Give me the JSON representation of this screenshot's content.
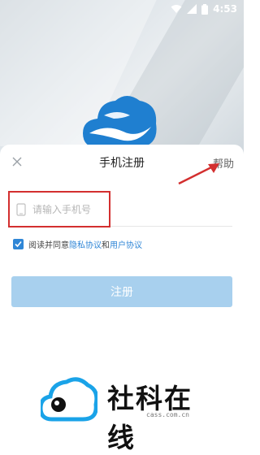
{
  "status_bar": {
    "time": "4:53",
    "icons": [
      "wifi-icon",
      "signal-icon",
      "battery-icon"
    ]
  },
  "header": {
    "close_icon": "close-icon",
    "title": "手机注册",
    "help_label": "帮助"
  },
  "form": {
    "phone_placeholder": "请输入手机号",
    "phone_value": "",
    "agree_prefix": "阅读并同意",
    "privacy_link": "隐私协议",
    "and_text": "和",
    "user_link": "用户协议",
    "agree_checked": true,
    "submit_label": "注册"
  },
  "watermark": {
    "text": "社科在线",
    "domain": "cass.com.cn"
  },
  "colors": {
    "accent": "#2f86d6",
    "button_disabled": "#a8d0ee",
    "annotation_red": "#d32f2f"
  }
}
